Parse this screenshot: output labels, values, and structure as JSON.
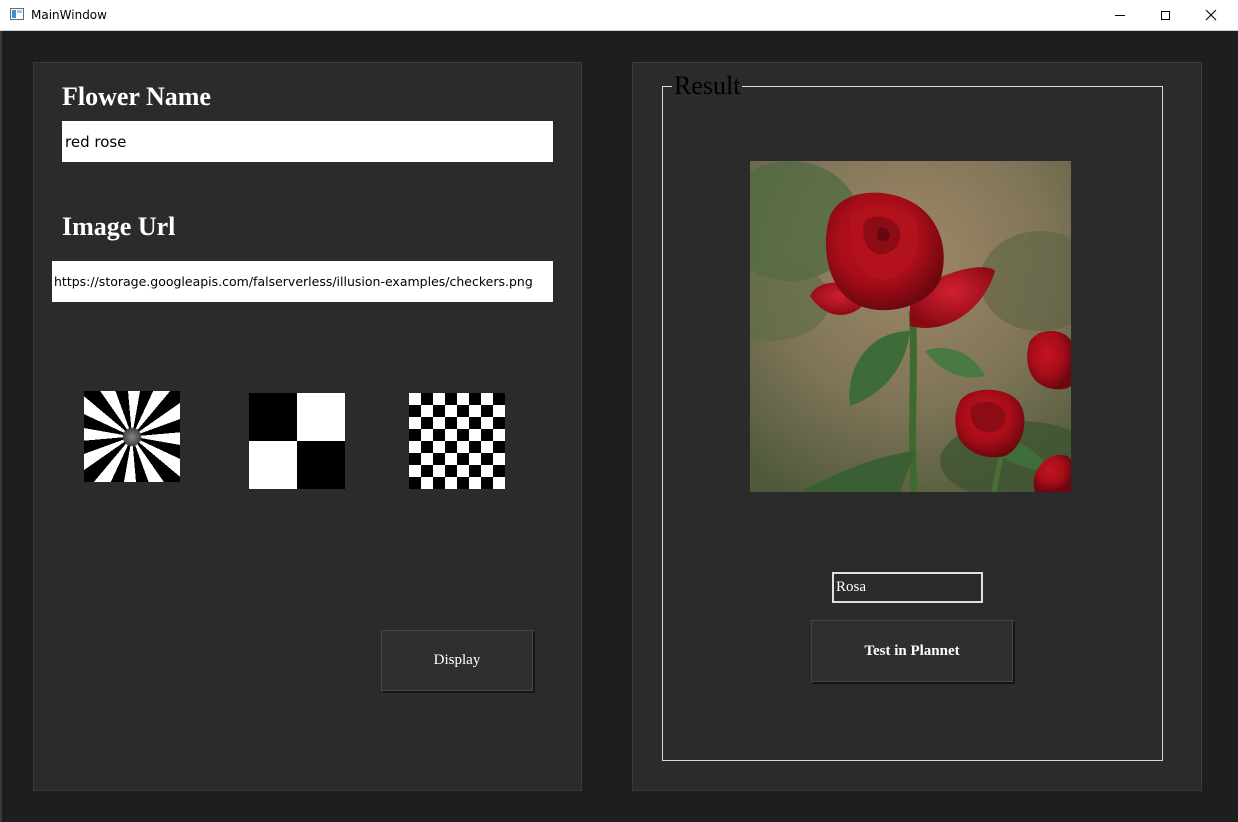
{
  "window": {
    "title": "MainWindow",
    "controls": {
      "minimize": "minimize-icon",
      "maximize": "maximize-icon",
      "close": "close-icon"
    }
  },
  "left": {
    "flower_name_label": "Flower Name",
    "flower_name_value": "red rose",
    "image_url_label": "Image Url",
    "image_url_value": "https://storage.googleapis.com/falserverless/illusion-examples/checkers.png",
    "thumbnails": [
      {
        "name": "spiral-thumbnail"
      },
      {
        "name": "large-checkers-thumbnail"
      },
      {
        "name": "small-checkers-thumbnail"
      }
    ],
    "display_button_label": "Display"
  },
  "right": {
    "group_title": "Result",
    "image_subject": "red rose photo",
    "result_value": "Rosa",
    "test_button_label": "Test in Plannet"
  },
  "colors": {
    "background": "#1e1e1e",
    "panel": "#2b2b2b",
    "text": "#ffffff"
  }
}
